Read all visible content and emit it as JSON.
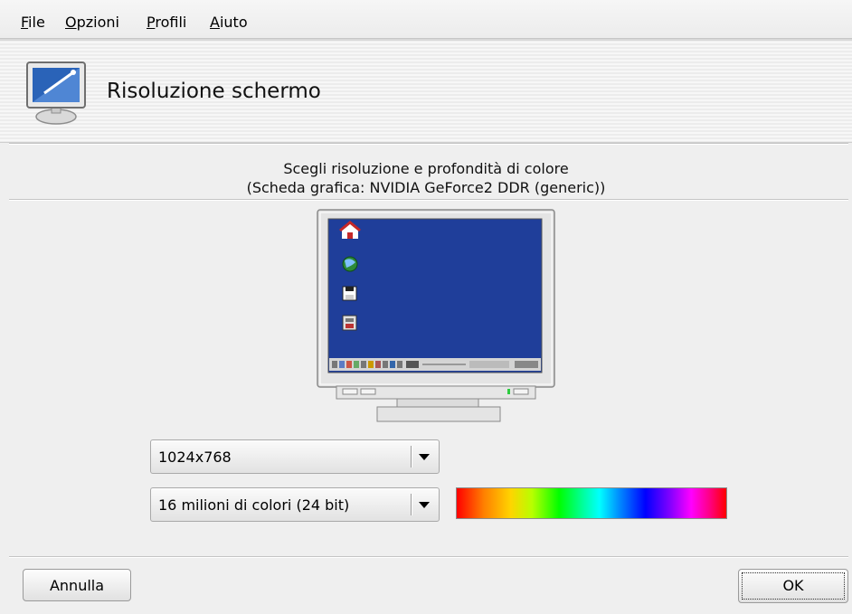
{
  "menubar": {
    "items": [
      "File",
      "Opzioni",
      "Profili",
      "Aiuto"
    ]
  },
  "header": {
    "title": "Risoluzione schermo",
    "icon": "monitor-settings-icon"
  },
  "main": {
    "subtitle_line1": "Scegli risoluzione e profondità di colore",
    "subtitle_line2": "(Scheda grafica: NVIDIA GeForce2 DDR (generic))",
    "resolution_select": {
      "selected": "1024x768"
    },
    "depth_select": {
      "selected": "16 milioni di colori (24 bit)"
    },
    "preview_icons": [
      "home-icon",
      "globe-icon",
      "floppy-icon",
      "floppy-drive-icon"
    ]
  },
  "footer": {
    "cancel_label": "Annulla",
    "ok_label": "OK"
  },
  "colors": {
    "desktop_bg": "#1f3e9a",
    "window_bg": "#efefef"
  }
}
